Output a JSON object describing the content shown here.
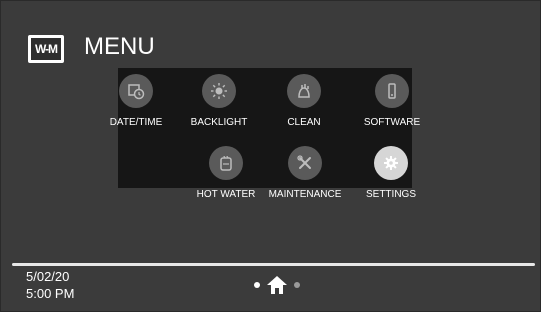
{
  "header": {
    "logo_text": "W-M",
    "title": "MENU"
  },
  "menu": {
    "items": [
      {
        "label": "DATE/TIME",
        "icon": "calendar-clock-icon"
      },
      {
        "label": "BACKLIGHT",
        "icon": "backlight-sun-icon"
      },
      {
        "label": "CLEAN",
        "icon": "clean-hand-icon"
      },
      {
        "label": "SOFTWARE",
        "icon": "software-device-icon"
      },
      {
        "label": "HOT WATER",
        "icon": "hot-water-tank-icon"
      },
      {
        "label": "MAINTENANCE",
        "icon": "wrench-screwdriver-icon"
      },
      {
        "label": "SETTINGS",
        "icon": "gear-icon",
        "active": true
      }
    ]
  },
  "footer": {
    "date": "5/02/20",
    "time": "5:00 PM"
  },
  "colors": {
    "background": "#3b3b3b",
    "menu_panel": "#161616",
    "icon_inactive": "#5a5a5a",
    "icon_active": "#d6d6d6"
  }
}
